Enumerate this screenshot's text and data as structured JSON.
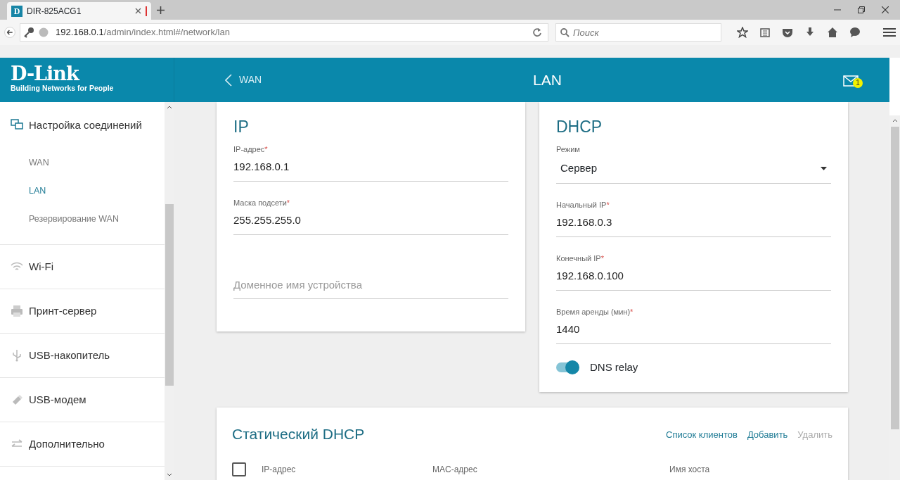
{
  "browser": {
    "tab": {
      "favicon_letter": "D",
      "title": "DIR-825ACG1"
    },
    "url_host": "192.168.0.1",
    "url_path": "/admin/index.html#/network/lan",
    "search": {
      "placeholder": "Поиск"
    }
  },
  "header": {
    "logo": "D-Link",
    "tagline": "Building Networks for People",
    "back_label": "WAN",
    "title": "LAN",
    "notification_count": "1"
  },
  "sidebar": {
    "items": [
      {
        "label": "Настройка соединений",
        "expanded": true,
        "children": [
          {
            "label": "WAN",
            "selected": false
          },
          {
            "label": "LAN",
            "selected": true
          },
          {
            "label": "Резервирование WAN",
            "selected": false
          }
        ]
      },
      {
        "label": "Wi-Fi",
        "expanded": false
      },
      {
        "label": "Принт-сервер",
        "expanded": false
      },
      {
        "label": "USB-накопитель",
        "expanded": false
      },
      {
        "label": "USB-модем",
        "expanded": false
      },
      {
        "label": "Дополнительно",
        "expanded": false
      }
    ]
  },
  "ip_card": {
    "title": "IP",
    "fields": [
      {
        "label": "IP-адрес",
        "required_mark": "*",
        "value": "192.168.0.1"
      },
      {
        "label": "Маска подсети",
        "required_mark": "*",
        "value": "255.255.255.0"
      },
      {
        "placeholder": "Доменное имя устройства"
      }
    ]
  },
  "dhcp_card": {
    "title": "DHCP",
    "mode": {
      "label": "Режим",
      "value": "Сервер"
    },
    "fields": [
      {
        "label": "Начальный IP",
        "required_mark": "*",
        "value": "192.168.0.3"
      },
      {
        "label": "Конечный IP",
        "required_mark": "*",
        "value": "192.168.0.100"
      },
      {
        "label": "Время аренды (мин)",
        "required_mark": "*",
        "value": "1440"
      }
    ],
    "dns_relay": {
      "label": "DNS relay",
      "on": true
    }
  },
  "static_dhcp": {
    "title": "Статический DHCP",
    "actions": [
      {
        "label": "Список клиентов",
        "disabled": false
      },
      {
        "label": "Добавить",
        "disabled": false
      },
      {
        "label": "Удалить",
        "disabled": true
      }
    ],
    "select_all_checked": false,
    "columns": [
      "IP-адрес",
      "MAC-адрес",
      "Имя хоста"
    ]
  }
}
